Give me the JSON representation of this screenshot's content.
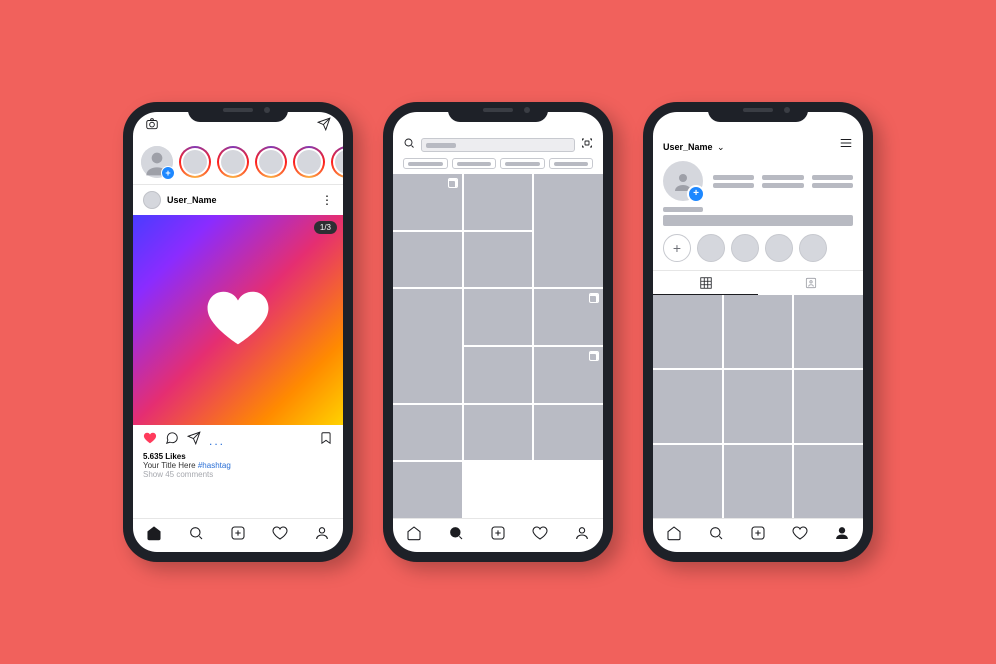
{
  "feed": {
    "user_name": "User_Name",
    "post_counter": "1/3",
    "likes_text": "5.635 Likes",
    "caption_prefix": "Your Title Here",
    "hashtag": "#hashtag",
    "comments_text": "Show 45 comments",
    "more_dots": "..."
  },
  "profile": {
    "user_name": "User_Name",
    "dropdown_glyph": "⌄"
  },
  "icons": {
    "person": "◉"
  }
}
